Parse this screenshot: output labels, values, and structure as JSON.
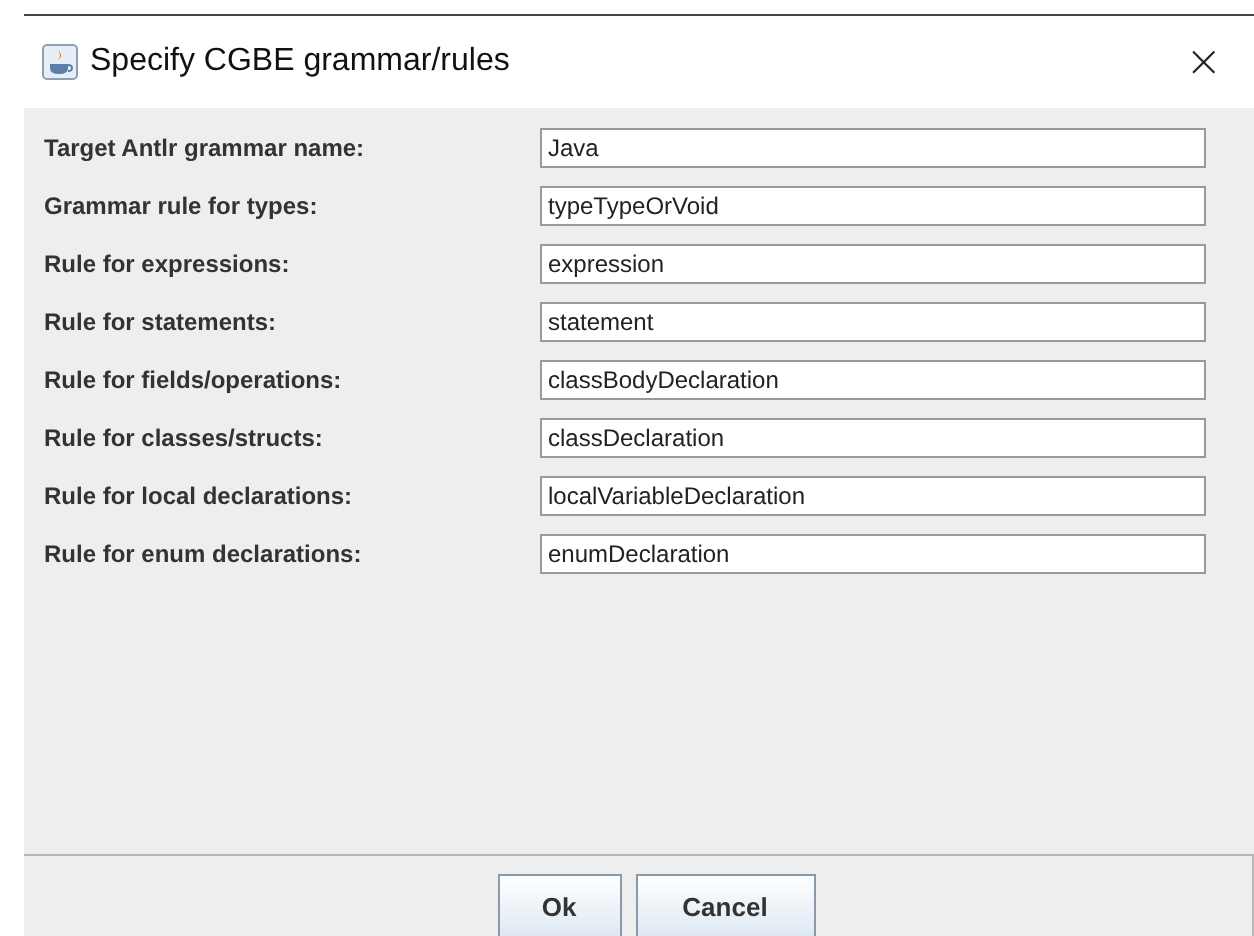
{
  "window": {
    "title": "Specify CGBE grammar/rules",
    "close": "×"
  },
  "fields": [
    {
      "label": "Target Antlr grammar name:",
      "value": "Java"
    },
    {
      "label": "Grammar rule for types:",
      "value": "typeTypeOrVoid"
    },
    {
      "label": "Rule for expressions:",
      "value": "expression"
    },
    {
      "label": "Rule for statements:",
      "value": "statement"
    },
    {
      "label": "Rule for fields/operations:",
      "value": "classBodyDeclaration"
    },
    {
      "label": "Rule for classes/structs:",
      "value": "classDeclaration"
    },
    {
      "label": "Rule for local declarations:",
      "value": "localVariableDeclaration"
    },
    {
      "label": "Rule for enum declarations:",
      "value": "enumDeclaration"
    }
  ],
  "buttons": [
    "Ok",
    "Cancel"
  ]
}
